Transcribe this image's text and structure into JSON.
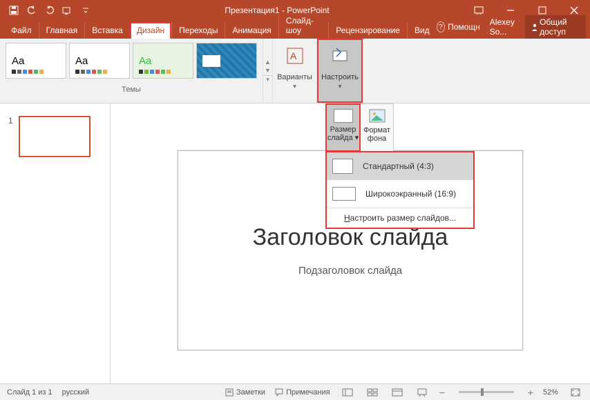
{
  "titlebar": {
    "title": "Презентация1 - PowerPoint"
  },
  "tabs": {
    "file": "Файл",
    "home": "Главная",
    "insert": "Вставка",
    "design": "Дизайн",
    "transitions": "Переходы",
    "animations": "Анимация",
    "slideshow": "Слайд-шоу",
    "review": "Рецензирование",
    "view": "Вид",
    "help": "Помощн",
    "user": "Alexey So...",
    "share": "Общий доступ"
  },
  "ribbon": {
    "themes_label": "Темы",
    "variants": "Варианты",
    "configure": "Настроить"
  },
  "subpanel": {
    "size": "Размер\nслайда",
    "format": "Формат\nфона"
  },
  "dropdown": {
    "standard": "Стандартный (4:3)",
    "wide": "Широкоэкранный (16:9)",
    "custom": "Настроить размер слайдов..."
  },
  "slidepanel": {
    "num": "1"
  },
  "slide": {
    "title": "Заголовок слайда",
    "subtitle": "Подзаголовок слайда"
  },
  "status": {
    "slide": "Слайд 1 из 1",
    "lang": "русский",
    "notes": "Заметки",
    "comments": "Примечания",
    "zoom": "52%"
  }
}
